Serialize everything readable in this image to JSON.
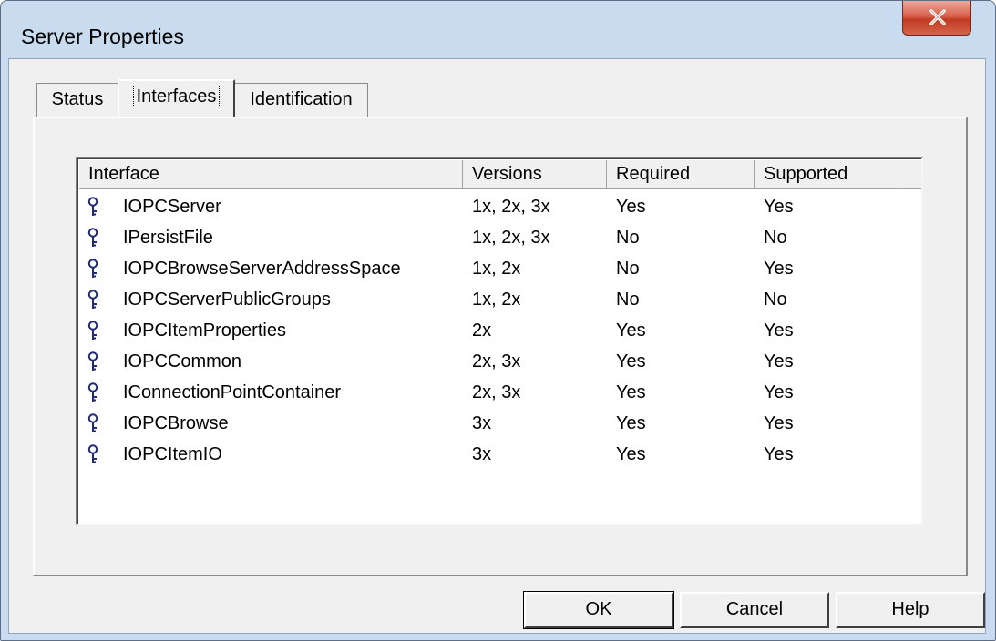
{
  "window": {
    "title": "Server Properties",
    "close_glyph": "X"
  },
  "tabs": [
    {
      "label": "Status"
    },
    {
      "label": "Interfaces",
      "active": true
    },
    {
      "label": "Identification"
    }
  ],
  "list": {
    "columns": [
      "Interface",
      "Versions",
      "Required",
      "Supported"
    ],
    "row_icon": "key-icon",
    "rows": [
      {
        "interface": "IOPCServer",
        "versions": "1x, 2x, 3x",
        "required": "Yes",
        "supported": "Yes"
      },
      {
        "interface": "IPersistFile",
        "versions": "1x, 2x, 3x",
        "required": "No",
        "supported": "No"
      },
      {
        "interface": "IOPCBrowseServerAddressSpace",
        "versions": "1x, 2x",
        "required": "No",
        "supported": "Yes"
      },
      {
        "interface": "IOPCServerPublicGroups",
        "versions": "1x, 2x",
        "required": "No",
        "supported": "No"
      },
      {
        "interface": "IOPCItemProperties",
        "versions": "2x",
        "required": "Yes",
        "supported": "Yes"
      },
      {
        "interface": "IOPCCommon",
        "versions": "2x, 3x",
        "required": "Yes",
        "supported": "Yes"
      },
      {
        "interface": "IConnectionPointContainer",
        "versions": "2x, 3x",
        "required": "Yes",
        "supported": "Yes"
      },
      {
        "interface": "IOPCBrowse",
        "versions": "3x",
        "required": "Yes",
        "supported": "Yes"
      },
      {
        "interface": "IOPCItemIO",
        "versions": "3x",
        "required": "Yes",
        "supported": "Yes"
      }
    ]
  },
  "buttons": {
    "ok": "OK",
    "cancel": "Cancel",
    "help": "Help"
  },
  "colors": {
    "frame": "#c9dbee",
    "client": "#f0f0f0",
    "close_button": "#c13a22",
    "key_icon": "#1f2a78"
  }
}
